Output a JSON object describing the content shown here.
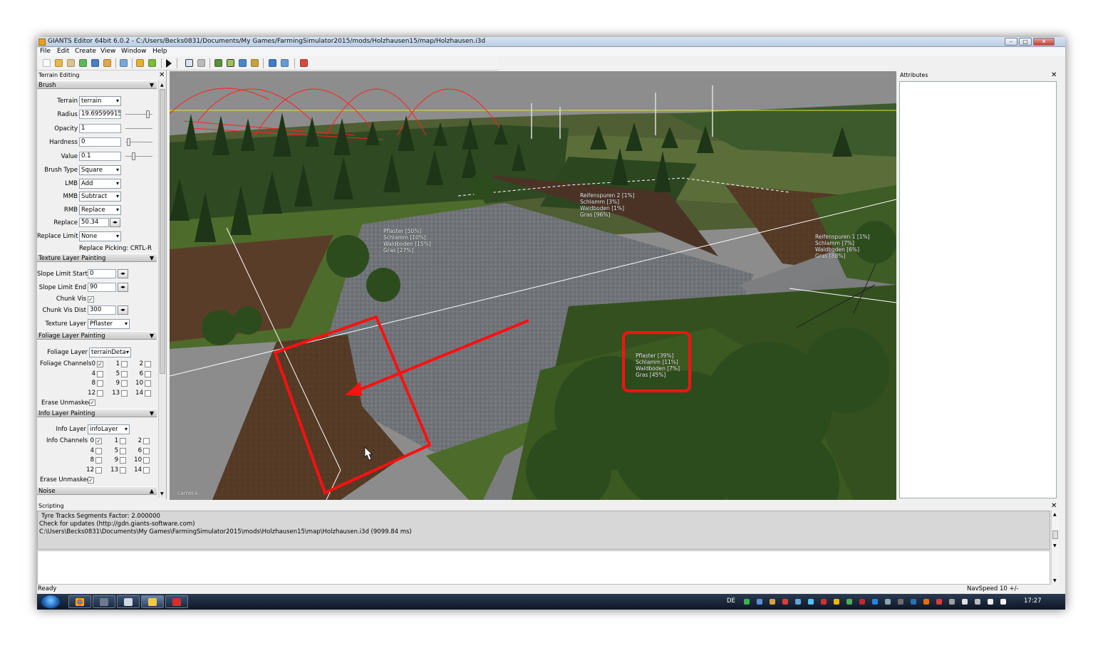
{
  "window": {
    "title": "GIANTS Editor 64bit 6.0.2 - C:/Users/Becks0831/Documents/My Games/FarmingSimulator2015/mods/Holzhausen15/map/Holzhausen.i3d",
    "minimize": "–",
    "maximize": "□",
    "close": "✕"
  },
  "menu": [
    "File",
    "Edit",
    "Create",
    "View",
    "Window",
    "Help"
  ],
  "toolbar": {
    "icons": [
      "new-file-icon",
      "open-file-icon",
      "edit-icon",
      "refresh-icon",
      "save-icon",
      "export-icon",
      "import-icon",
      "undo-icon",
      "redo-icon",
      "play-icon",
      "select-tool-icon",
      "move-tool-icon",
      "terrain-sculpt-icon",
      "terrain-paint-icon",
      "foliage-paint-icon",
      "info-paint-icon",
      "world-icon",
      "settings-icon",
      "plugin-icon"
    ]
  },
  "terrain_editing": {
    "panel_title": "Terrain Editing",
    "close": "✕",
    "brush": {
      "section": "Brush",
      "terrain_label": "Terrain",
      "terrain_value": "terrain",
      "radius_label": "Radius",
      "radius_value": "19.69599915",
      "opacity_label": "Opacity",
      "opacity_value": "1",
      "hardness_label": "Hardness",
      "hardness_value": "0",
      "value_label": "Value",
      "value_value": "0.1",
      "brush_type_label": "Brush Type",
      "brush_type_value": "Square",
      "lmb_label": "LMB",
      "lmb_value": "Add",
      "mmb_label": "MMB",
      "mmb_value": "Subtract",
      "rmb_label": "RMB",
      "rmb_value": "Replace",
      "replace_label": "Replace",
      "replace_value": "50.34",
      "replace_limit_label": "Replace Limit",
      "replace_limit_value": "None",
      "replace_picking": "Replace Picking: CRTL-R",
      "radius_slider": 0.9,
      "hardness_slider": 0.05,
      "value_slider": 0.25
    },
    "texture_layer": {
      "section": "Texture Layer Painting",
      "slope_start_label": "Slope Limit Start",
      "slope_start_value": "0",
      "slope_end_label": "Slope Limit End",
      "slope_end_value": "90",
      "chunk_vis_label": "Chunk Vis",
      "chunk_vis_checked": true,
      "chunk_vis_dist_label": "Chunk Vis Dist",
      "chunk_vis_dist_value": "300",
      "texture_layer_label": "Texture Layer",
      "texture_layer_value": "Pflaster"
    },
    "foliage_layer": {
      "section": "Foliage Layer Painting",
      "foliage_layer_label": "Foliage Layer",
      "foliage_layer_value": "terrainDeta",
      "channels_label": "Foliage Channels",
      "channels": [
        {
          "n": "0",
          "checked": true
        },
        {
          "n": "1",
          "checked": false
        },
        {
          "n": "2",
          "checked": false
        },
        {
          "n": "4",
          "checked": false
        },
        {
          "n": "5",
          "checked": false
        },
        {
          "n": "6",
          "checked": false
        },
        {
          "n": "8",
          "checked": false
        },
        {
          "n": "9",
          "checked": false
        },
        {
          "n": "10",
          "checked": false
        },
        {
          "n": "12",
          "checked": false
        },
        {
          "n": "13",
          "checked": false
        },
        {
          "n": "14",
          "checked": false
        }
      ],
      "erase_unmasked_label": "Erase Unmasked",
      "erase_unmasked_checked": true
    },
    "info_layer": {
      "section": "Info Layer Painting",
      "info_layer_label": "Info Layer",
      "info_layer_value": "infoLayer",
      "channels_label": "Info Channels",
      "channels": [
        {
          "n": "0",
          "checked": true
        },
        {
          "n": "1",
          "checked": false
        },
        {
          "n": "2",
          "checked": false
        },
        {
          "n": "4",
          "checked": false
        },
        {
          "n": "5",
          "checked": false
        },
        {
          "n": "6",
          "checked": false
        },
        {
          "n": "8",
          "checked": false
        },
        {
          "n": "9",
          "checked": false
        },
        {
          "n": "10",
          "checked": false
        },
        {
          "n": "12",
          "checked": false
        },
        {
          "n": "13",
          "checked": false
        },
        {
          "n": "14",
          "checked": false
        }
      ],
      "erase_unmasked_label": "Erase Unmasked",
      "erase_unmasked_checked": true
    },
    "noise": {
      "section": "Noise"
    }
  },
  "viewport": {
    "camera_label": "camera",
    "info_labels": [
      {
        "lines": [
          "Pflaster [50%]",
          "Schlamm [10%]",
          "Waldboden [15%]",
          "Gras [27%]"
        ]
      },
      {
        "lines": [
          "Reifenspuren 2 [1%]",
          "Schlamm [3%]",
          "Waldboden [1%]",
          "Gras [96%]"
        ]
      },
      {
        "lines": [
          "Reifenspuren 1 [1%]",
          "Schlamm [7%]",
          "Waldboden [6%]",
          "Gras [88%]"
        ]
      },
      {
        "lines": [
          "Pflaster [39%]",
          "Schlamm [11%]",
          "Waldboden [7%]",
          "Gras [45%]"
        ]
      }
    ],
    "colors": {
      "sky": "#8d8d8d",
      "gravel": "#707478",
      "grass": "#4d6b2a",
      "soil": "#5a3d28",
      "highlight": "#ff1010"
    }
  },
  "attributes": {
    "panel_title": "Attributes",
    "close": "✕"
  },
  "scripting": {
    "panel_title": "Scripting",
    "close": "✕",
    "log": [
      "Tyre Tracks Segments Factor: 2.000000",
      "Check for updates (http://gdn.giants-software.com)",
      "C:\\Users\\Becks0831\\Documents\\My Games\\FarmingSimulator2015\\mods\\Holzhausen15\\map\\Holzhausen.i3d (9099.84 ms)"
    ]
  },
  "status": {
    "left": "Ready",
    "right": "NavSpeed 10 +/-"
  },
  "taskbar": {
    "apps": [
      "chrome-icon",
      "steam-icon",
      "explorer-icon",
      "folder-icon",
      "acrobat-icon"
    ],
    "lang": "DE",
    "time": "17:27"
  }
}
